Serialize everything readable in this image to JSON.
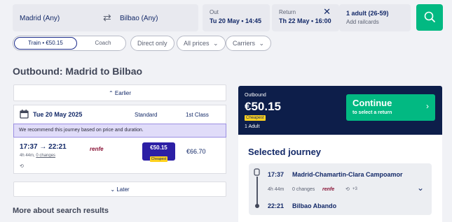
{
  "search": {
    "origin": "Madrid (Any)",
    "destination": "Bilbao (Any)",
    "out_label": "Out",
    "out_value": "Tu 20 May • 14:45",
    "return_label": "Return",
    "return_value": "Th 22 May • 16:00",
    "passengers": "1 adult (26-59)",
    "railcards": "Add railcards"
  },
  "filters": {
    "train_label": "Train • €50.15",
    "coach_label": "Coach",
    "direct_only": "Direct only",
    "all_prices": "All prices",
    "carriers": "Carriers"
  },
  "outbound_title": "Outbound: Madrid to Bilbao",
  "earlier_label": "Earlier",
  "later_label": "Later",
  "date_row": {
    "date": "Tue 20 May 2025",
    "standard": "Standard",
    "first_class": "1st Class"
  },
  "recommendation": "We recommend this journey based on price and duration.",
  "journey": {
    "depart": "17:37",
    "arrive": "22:21",
    "duration": "4h 44m,",
    "changes": "0 changes",
    "carrier": "renfe",
    "standard_price": "€50.15",
    "badge": "Cheapest",
    "first_price": "€66.70"
  },
  "more_about": "More about search results",
  "summary": {
    "label": "Outbound",
    "price": "€50.15",
    "badge": "Cheapest",
    "pax": "1 Adult",
    "continue_title": "Continue",
    "continue_sub": "to select a return"
  },
  "selected": {
    "title": "Selected journey",
    "depart_time": "17:37",
    "depart_station": "Madrid-Chamartin-Clara Campoamor",
    "duration": "4h 44m",
    "changes": "0 changes",
    "carrier": "renfe",
    "extras": "+3",
    "arrive_time": "22:21",
    "arrive_station": "Bilbao Abando"
  },
  "colors": {
    "brand_green": "#02b982",
    "navy": "#0d1e4a",
    "price_purple": "#2c1fa5",
    "cheapest_yellow": "#ffd21e",
    "renfe_red": "#8a1538"
  }
}
